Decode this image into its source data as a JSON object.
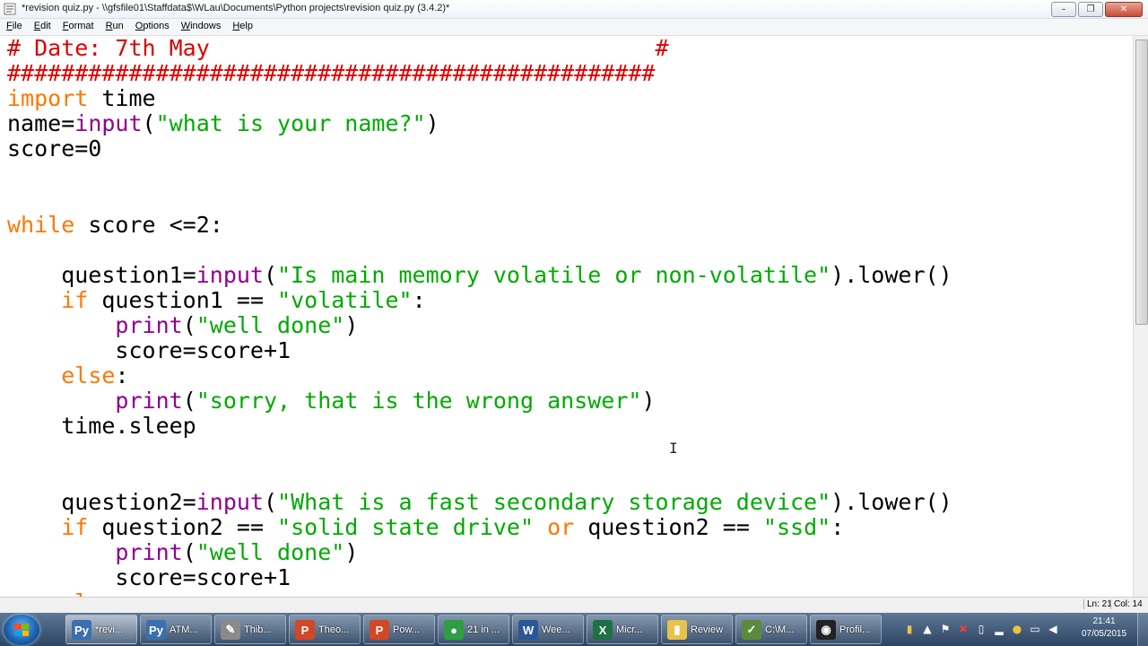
{
  "window": {
    "title": "*revision quiz.py - \\\\gfsfile01\\Staffdata$\\WLau\\Documents\\Python projects\\revision quiz.py (3.4.2)*",
    "minimize": "–",
    "maximize": "❐",
    "close": "✕"
  },
  "menu": [
    {
      "accel": "F",
      "rest": "ile"
    },
    {
      "accel": "E",
      "rest": "dit"
    },
    {
      "accel": "F",
      "rest": "ormat"
    },
    {
      "accel": "R",
      "rest": "un"
    },
    {
      "accel": "O",
      "rest": "ptions"
    },
    {
      "accel": "W",
      "rest": "indows"
    },
    {
      "accel": "H",
      "rest": "elp"
    }
  ],
  "code_lines": [
    [
      {
        "t": "# Date: 7th May                                 #",
        "c": "c"
      }
    ],
    [
      {
        "t": "################################################",
        "c": "c"
      }
    ],
    [
      {
        "t": "import",
        "c": "k"
      },
      {
        "t": " time",
        "c": ""
      }
    ],
    [
      {
        "t": "name=",
        "c": ""
      },
      {
        "t": "input",
        "c": "b"
      },
      {
        "t": "(",
        "c": ""
      },
      {
        "t": "\"what is your name?\"",
        "c": "s"
      },
      {
        "t": ")",
        "c": ""
      }
    ],
    [
      {
        "t": "score=0",
        "c": ""
      }
    ],
    [],
    [],
    [
      {
        "t": "while",
        "c": "k"
      },
      {
        "t": " score <=2:",
        "c": ""
      }
    ],
    [],
    [
      {
        "t": "    question1=",
        "c": ""
      },
      {
        "t": "input",
        "c": "b"
      },
      {
        "t": "(",
        "c": ""
      },
      {
        "t": "\"Is main memory volatile or non-volatile\"",
        "c": "s"
      },
      {
        "t": ").lower()",
        "c": ""
      }
    ],
    [
      {
        "t": "    ",
        "c": ""
      },
      {
        "t": "if",
        "c": "k"
      },
      {
        "t": " question1 == ",
        "c": ""
      },
      {
        "t": "\"volatile\"",
        "c": "s"
      },
      {
        "t": ":",
        "c": ""
      }
    ],
    [
      {
        "t": "        ",
        "c": ""
      },
      {
        "t": "print",
        "c": "b"
      },
      {
        "t": "(",
        "c": ""
      },
      {
        "t": "\"well done\"",
        "c": "s"
      },
      {
        "t": ")",
        "c": ""
      }
    ],
    [
      {
        "t": "        score=score+1",
        "c": ""
      }
    ],
    [
      {
        "t": "    ",
        "c": ""
      },
      {
        "t": "else",
        "c": "k"
      },
      {
        "t": ":",
        "c": ""
      }
    ],
    [
      {
        "t": "        ",
        "c": ""
      },
      {
        "t": "print",
        "c": "b"
      },
      {
        "t": "(",
        "c": ""
      },
      {
        "t": "\"sorry, that is the wrong answer\"",
        "c": "s"
      },
      {
        "t": ")",
        "c": ""
      }
    ],
    [
      {
        "t": "    time.sleep",
        "c": ""
      }
    ],
    [],
    [],
    [
      {
        "t": "    question2=",
        "c": ""
      },
      {
        "t": "input",
        "c": "b"
      },
      {
        "t": "(",
        "c": ""
      },
      {
        "t": "\"What is a fast secondary storage device\"",
        "c": "s"
      },
      {
        "t": ").lower()",
        "c": ""
      }
    ],
    [
      {
        "t": "    ",
        "c": ""
      },
      {
        "t": "if",
        "c": "k"
      },
      {
        "t": " question2 == ",
        "c": ""
      },
      {
        "t": "\"solid state drive\"",
        "c": "s"
      },
      {
        "t": " ",
        "c": ""
      },
      {
        "t": "or",
        "c": "k"
      },
      {
        "t": " question2 == ",
        "c": ""
      },
      {
        "t": "\"ssd\"",
        "c": "s"
      },
      {
        "t": ":",
        "c": ""
      }
    ],
    [
      {
        "t": "        ",
        "c": ""
      },
      {
        "t": "print",
        "c": "b"
      },
      {
        "t": "(",
        "c": ""
      },
      {
        "t": "\"well done\"",
        "c": "s"
      },
      {
        "t": ")",
        "c": ""
      }
    ],
    [
      {
        "t": "        score=score+1",
        "c": ""
      }
    ],
    [
      {
        "t": "    ",
        "c": ""
      },
      {
        "t": "el",
        "c": "k"
      }
    ]
  ],
  "status": {
    "line": "Ln: 21",
    "col": "Col: 14"
  },
  "taskbar": {
    "items": [
      {
        "label": "*revi...",
        "icon": "python-icon",
        "color": "#3a6fb0",
        "glyph": "Py",
        "active": true
      },
      {
        "label": "ATM...",
        "icon": "python-icon",
        "color": "#3a6fb0",
        "glyph": "Py",
        "active": false
      },
      {
        "label": "Thib...",
        "icon": "pen-icon",
        "color": "#8a8a8a",
        "glyph": "✎",
        "active": false
      },
      {
        "label": "Theo...",
        "icon": "powerpoint-icon",
        "color": "#d24726",
        "glyph": "P",
        "active": false
      },
      {
        "label": "Pow...",
        "icon": "powerpoint-icon",
        "color": "#d24726",
        "glyph": "P",
        "active": false
      },
      {
        "label": "21 in ...",
        "icon": "chrome-icon",
        "color": "#2e9e44",
        "glyph": "●",
        "active": false
      },
      {
        "label": "Wee...",
        "icon": "word-icon",
        "color": "#2b5797",
        "glyph": "W",
        "active": false
      },
      {
        "label": "Micr...",
        "icon": "excel-icon",
        "color": "#1e7145",
        "glyph": "X",
        "active": false
      },
      {
        "label": "Review",
        "icon": "folder-icon",
        "color": "#e8c34a",
        "glyph": "▮",
        "active": false
      },
      {
        "label": "C:\\M...",
        "icon": "notepad-icon",
        "color": "#5b8a3c",
        "glyph": "✓",
        "active": false
      },
      {
        "label": "Profil...",
        "icon": "obs-icon",
        "color": "#222222",
        "glyph": "◉",
        "active": false
      }
    ],
    "time": "21:41",
    "date": "07/05/2015"
  }
}
